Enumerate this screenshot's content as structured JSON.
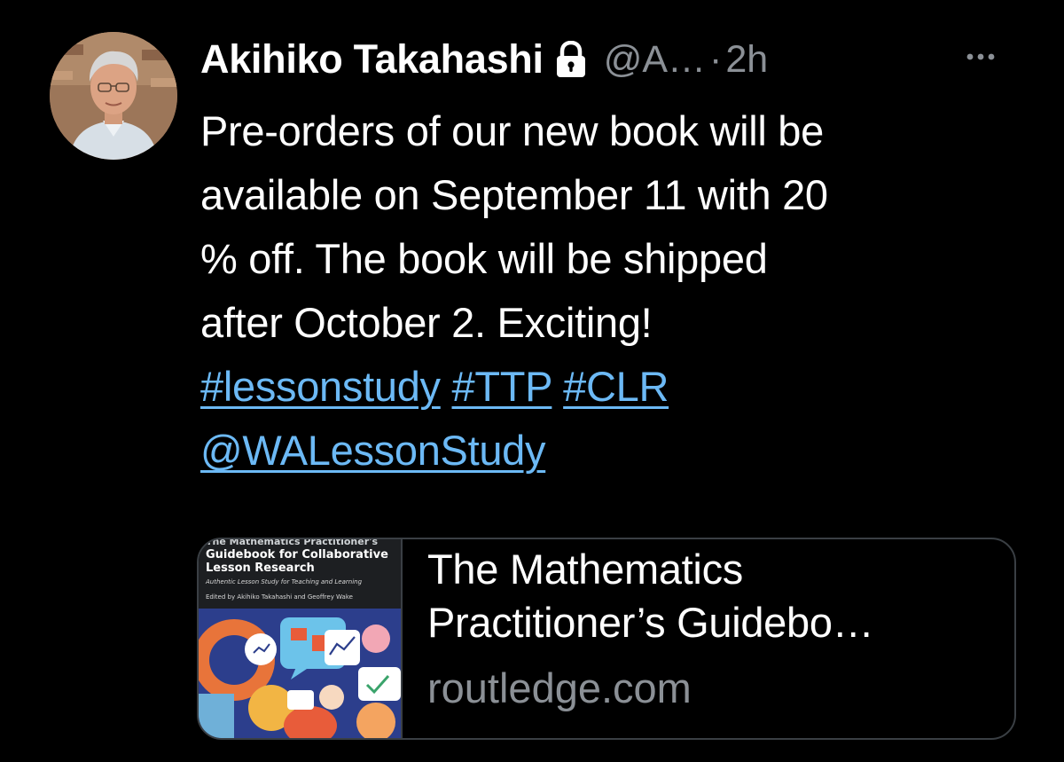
{
  "tweet": {
    "author": {
      "display_name": "Akihiko Takahashi",
      "handle": "@A…",
      "protected_icon": "lock-icon",
      "avatar_icon": "profile-photo"
    },
    "separator": "·",
    "timestamp": "2h",
    "more_icon": "more-horizontal-icon",
    "text_lines": [
      "Pre-orders of our new book will be",
      "available on September 11 with 20",
      "% off. The book will be shipped",
      "after October 2. Exciting!"
    ],
    "hashtags": [
      "#lessonstudy",
      "#TTP",
      "#CLR"
    ],
    "mention": "@WALessonStudy",
    "link_card": {
      "title_lines": [
        "The Mathematics",
        "Practitioner’s Guidebo…"
      ],
      "domain": "routledge.com",
      "cover": {
        "series": "The Mathematics Practitioner's",
        "title_lines": [
          "Guidebook for Collaborative",
          "Lesson Research"
        ],
        "subtitle": "Authentic Lesson Study for Teaching and Learning",
        "editors": "Edited by Akihiko Takahashi and Geoffrey Wake"
      }
    }
  },
  "colors": {
    "background": "#000000",
    "text_primary": "#ffffff",
    "text_secondary": "#8b9096",
    "link": "#6cb9f5",
    "card_border": "#3a3f44"
  }
}
